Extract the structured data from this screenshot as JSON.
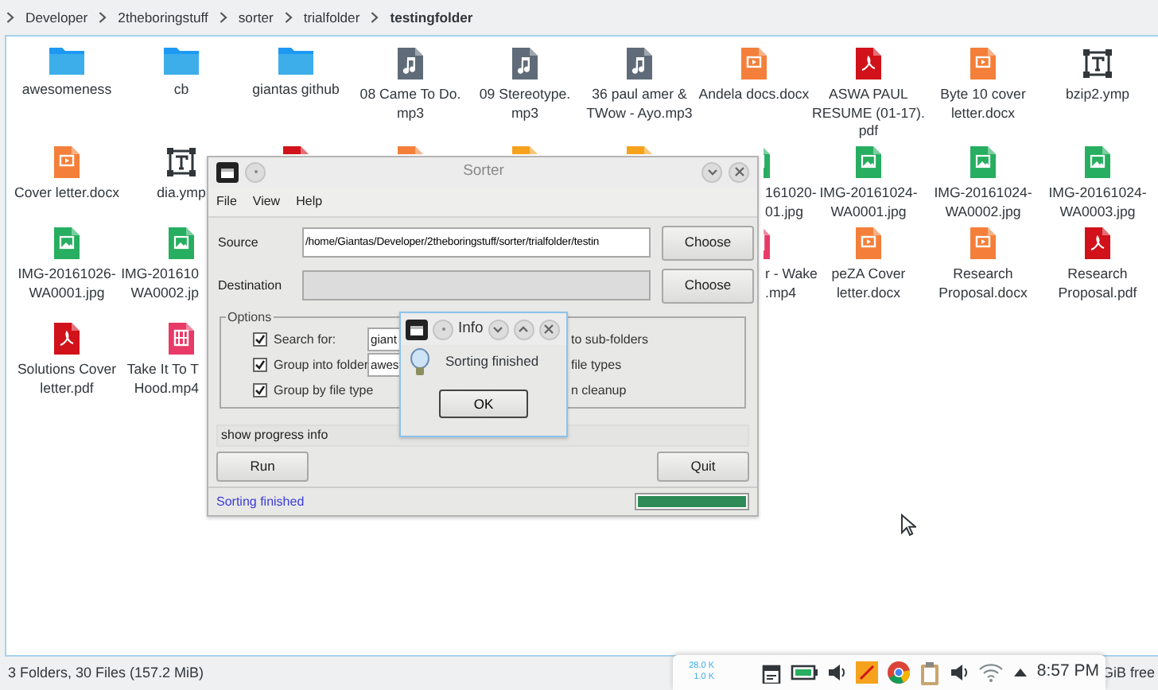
{
  "breadcrumb": [
    {
      "label": "Developer",
      "selected": false
    },
    {
      "label": "2theboringstuff",
      "selected": false
    },
    {
      "label": "sorter",
      "selected": false
    },
    {
      "label": "trialfolder",
      "selected": false
    },
    {
      "label": "testingfolder",
      "selected": true
    }
  ],
  "files": [
    {
      "items": [
        {
          "kind": "folder",
          "label": [
            "awesomeness"
          ]
        },
        {
          "kind": "folder",
          "label": [
            "cb"
          ]
        },
        {
          "kind": "folder",
          "label": [
            "giantas github"
          ]
        },
        {
          "kind": "audio",
          "label": [
            "08 Came To Do.",
            "mp3"
          ]
        },
        {
          "kind": "audio",
          "label": [
            "09 Stereotype.",
            "mp3"
          ]
        },
        {
          "kind": "audio",
          "label": [
            "36 paul amer &",
            "TWow - Ayo.mp3"
          ]
        },
        {
          "kind": "docx",
          "label": [
            "Andela docs.docx"
          ]
        },
        {
          "kind": "pdf",
          "label": [
            "ASWA PAUL",
            "RESUME (01-17).",
            "pdf"
          ]
        },
        {
          "kind": "docx",
          "label": [
            "Byte 10 cover",
            "letter.docx"
          ]
        },
        {
          "kind": "ymp",
          "label": [
            "bzip2.ymp"
          ]
        }
      ]
    },
    {
      "items": [
        {
          "kind": "docx",
          "label": [
            "Cover letter.docx"
          ]
        },
        {
          "kind": "ymp",
          "label": [
            "dia.ymp"
          ]
        },
        {
          "kind": "pdf",
          "covered": true
        },
        {
          "kind": "docx",
          "covered": true
        },
        {
          "kind": "archive",
          "covered": true
        },
        {
          "kind": "archive",
          "covered": true
        },
        {
          "kind": "image",
          "label": [
            "161020-",
            "01.jpg"
          ],
          "covered": true
        },
        {
          "kind": "image",
          "label": [
            "IMG-20161024-",
            "WA0001.jpg"
          ]
        },
        {
          "kind": "image",
          "label": [
            "IMG-20161024-",
            "WA0002.jpg"
          ]
        },
        {
          "kind": "image",
          "label": [
            "IMG-20161024-",
            "WA0003.jpg"
          ]
        }
      ]
    },
    {
      "items": [
        {
          "kind": "image",
          "label": [
            "IMG-20161026-",
            "WA0001.jpg"
          ]
        },
        {
          "kind": "image",
          "label": [
            "IMG-201610",
            "WA0002.jp"
          ],
          "covered": true
        }
      ],
      "right_items": [
        {
          "kind": "video",
          "label": [
            "r - Wake",
            ".mp4"
          ],
          "covered": true
        },
        {
          "kind": "docx",
          "label": [
            "peZA Cover",
            "letter.docx"
          ]
        },
        {
          "kind": "docx",
          "label": [
            "Research",
            "Proposal.docx"
          ]
        },
        {
          "kind": "pdf",
          "label": [
            "Research",
            "Proposal.pdf"
          ]
        }
      ]
    },
    {
      "items": [
        {
          "kind": "pdf",
          "label": [
            "Solutions Cover",
            "letter.pdf"
          ]
        },
        {
          "kind": "video",
          "label": [
            "Take It To T",
            "Hood.mp4"
          ],
          "covered": true
        }
      ]
    }
  ],
  "status_bar": {
    "summary": "3 Folders, 30 Files (157.2 MiB)",
    "free_space": "GiB free"
  },
  "sorter_window": {
    "title": "Sorter",
    "menu": [
      "File",
      "View",
      "Help"
    ],
    "source": {
      "label": "Source",
      "value": "/home/Giantas/Developer/2theboringstuff/sorter/trialfolder/testin",
      "button": "Choose",
      "disabled": false
    },
    "destination": {
      "label": "Destination",
      "button": "Choose",
      "disabled": true
    },
    "options": {
      "title": "Options",
      "items": [
        {
          "label": "Search for:",
          "checked": true,
          "value": "giant"
        },
        {
          "label": "Group into folder",
          "checked": true,
          "value": "awes"
        },
        {
          "label": "Group by file type",
          "checked": true
        }
      ],
      "right_items": [
        "to sub-folders",
        "file types",
        "n cleanup"
      ]
    },
    "progress_link": "show progress info",
    "run_button": "Run",
    "quit_button": "Quit",
    "status": "Sorting finished",
    "progress": {
      "level": 1
    }
  },
  "info_dialog": {
    "title": "Info",
    "message": "Sorting finished",
    "button": "OK"
  },
  "tray": {
    "net_down": "28.0 K",
    "net_up": "1.0 K",
    "clock": "8:57 PM"
  }
}
